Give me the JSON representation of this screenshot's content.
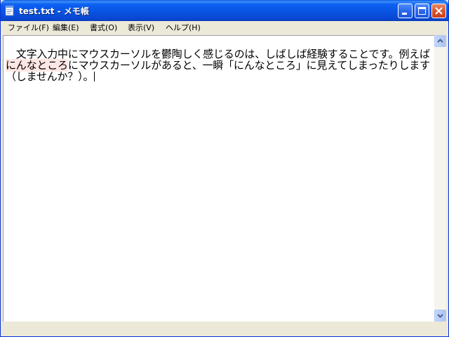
{
  "window": {
    "title": "test.txt - メモ帳"
  },
  "menu": {
    "file": "ファイル(F)",
    "edit": "編集(E)",
    "format": "書式(O)",
    "view": "表示(V)",
    "help": "ヘルプ(H)"
  },
  "document": {
    "text_before": "　文字入力中にマウスカーソルを鬱陶しく感じるのは、しばしば経験することです。例えば",
    "text_highlight": "にんなところ",
    "text_after": "にマウスカーソルがあると、一瞬「にんなところ」に見えてしまったりします（しませんか？）。"
  },
  "icons": {
    "app": "notepad-icon",
    "minimize": "minimize-icon",
    "maximize": "maximize-icon",
    "close": "close-icon",
    "scroll_up": "arrow-up-icon",
    "scroll_down": "arrow-down-icon"
  },
  "colors": {
    "titlebar": "#0a52e0",
    "close_button": "#d9572e",
    "highlight": "#fde6e3"
  }
}
